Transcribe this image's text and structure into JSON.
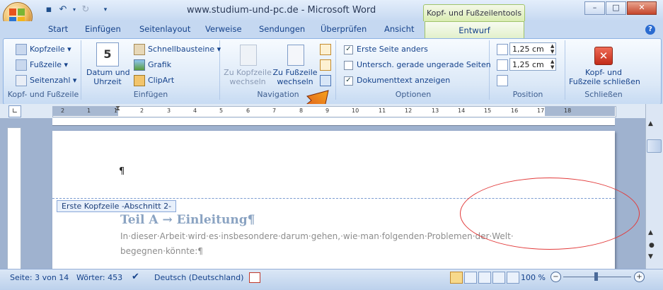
{
  "window": {
    "title": "www.studium-und-pc.de - Microsoft Word",
    "contextual_tab_header": "Kopf- und Fußzeilentools"
  },
  "tabs": [
    "Start",
    "Einfügen",
    "Seitenlayout",
    "Verweise",
    "Sendungen",
    "Überprüfen",
    "Ansicht",
    "Entwurf"
  ],
  "ribbon": {
    "group_header_footer": {
      "label": "Kopf- und Fußzeile",
      "kopfzeile": "Kopfzeile",
      "fusszeile": "Fußzeile",
      "seitenzahl": "Seitenzahl"
    },
    "group_insert": {
      "label": "Einfügen",
      "datum_line1": "Datum und",
      "datum_line2": "Uhrzeit",
      "schnellbausteine": "Schnellbausteine",
      "grafik": "Grafik",
      "clipart": "ClipArt"
    },
    "group_navigation": {
      "label": "Navigation",
      "zu_kopfzeile_line1": "Zu Kopfzeile",
      "zu_kopfzeile_line2": "wechseln",
      "zu_fusszeile_line1": "Zu Fußzeile",
      "zu_fusszeile_line2": "wechseln"
    },
    "group_options": {
      "label": "Optionen",
      "erste_seite": "Erste Seite anders",
      "untersch": "Untersch. gerade  ungerade Seiten",
      "dokumenttext": "Dokumenttext anzeigen"
    },
    "group_position": {
      "label": "Position",
      "top_value": "1,25 cm",
      "bottom_value": "1,25 cm"
    },
    "group_close": {
      "label": "Schließen",
      "close_line1": "Kopf- und",
      "close_line2": "Fußzeile schließen"
    }
  },
  "ruler": {
    "ticks": [
      "2",
      "1",
      "1",
      "2",
      "3",
      "4",
      "5",
      "6",
      "7",
      "8",
      "9",
      "10",
      "11",
      "12",
      "13",
      "14",
      "15",
      "16",
      "17",
      "18"
    ]
  },
  "document": {
    "header_tag": "Erste Kopfzeile -Abschnitt 2-",
    "heading": "Teil A   →   Einleitung¶",
    "para_line1": "In·dieser·Arbeit·wird·es·insbesondere·darum·gehen,·wie·man·folgenden·Problemen·der·Welt·",
    "para_line2": "begegnen·könnte:¶",
    "pilcrow": "¶"
  },
  "status": {
    "page": "Seite: 3 von 14",
    "words": "Wörter: 453",
    "language": "Deutsch (Deutschland)",
    "zoom": "100 %"
  },
  "colors": {
    "annotation_red": "#e23b3b",
    "arrow_orange": "#f07a1a"
  }
}
